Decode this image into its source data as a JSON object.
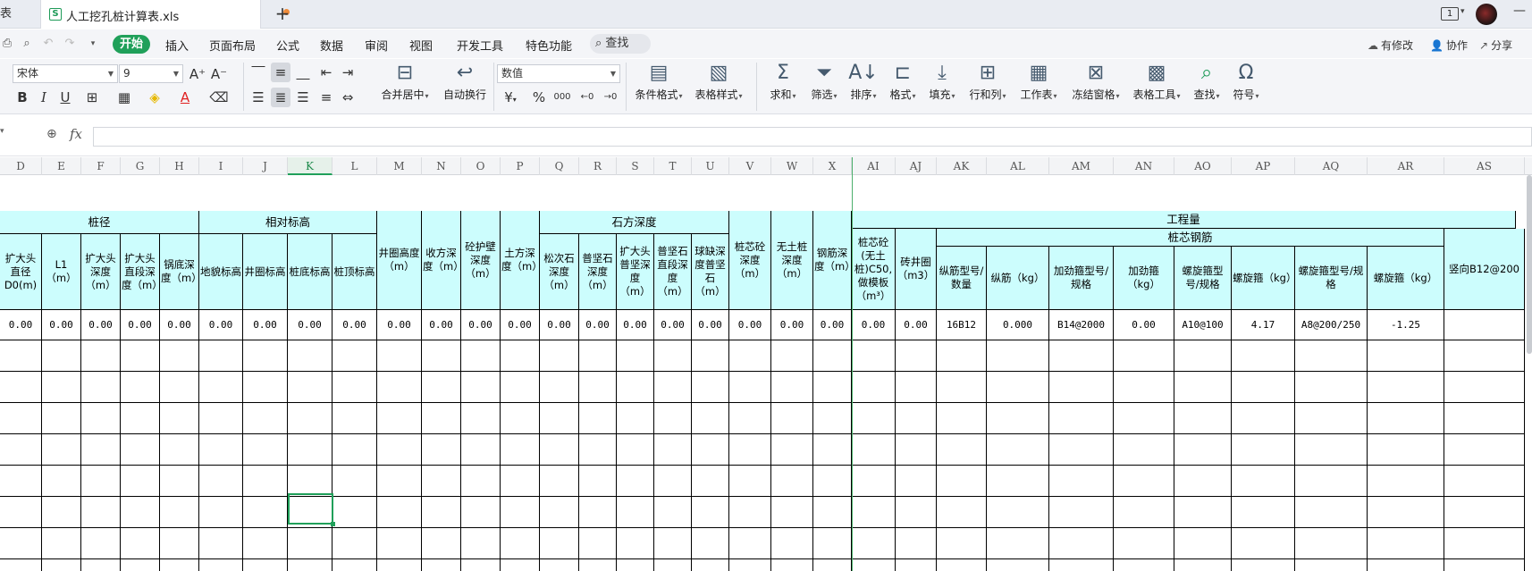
{
  "tabbar": {
    "prev_tab_label": "表",
    "doc_title": "人工挖孔桩计算表.xls",
    "new_tab": "+",
    "page_icon_label": "1"
  },
  "menu": {
    "items": [
      "开始",
      "插入",
      "页面布局",
      "公式",
      "数据",
      "审阅",
      "视图",
      "开发工具",
      "特色功能"
    ],
    "search": "查找",
    "right": [
      "有修改",
      "协作",
      "分享"
    ]
  },
  "ribbon": {
    "font_name": "宋体",
    "font_size": "9",
    "number_format": "数值",
    "merge_label": "合并居中",
    "wrap_label": "自动换行",
    "cond_format": "条件格式",
    "table_style": "表格样式",
    "tools": [
      "求和",
      "筛选",
      "排序",
      "格式",
      "填充",
      "行和列",
      "工作表",
      "冻结窗格",
      "表格工具",
      "查找",
      "符号"
    ],
    "currency": "¥",
    "percent": "%",
    "thousands": "000"
  },
  "formula": {
    "fx": "fx",
    "value": ""
  },
  "colors": {
    "header_bg": "#ccfdfd",
    "accent": "#20a05a"
  },
  "columns": [
    "D",
    "E",
    "F",
    "G",
    "H",
    "I",
    "J",
    "K",
    "L",
    "M",
    "N",
    "O",
    "P",
    "Q",
    "R",
    "S",
    "T",
    "U",
    "V",
    "W",
    "X",
    "AI",
    "AJ",
    "AK",
    "AL",
    "AM",
    "AN",
    "AO",
    "AP",
    "AQ",
    "AR",
    "AS"
  ],
  "groups": {
    "pile_diameter": "桩径",
    "relative_elev": "相对标高",
    "rock_depth": "石方深度",
    "quantities": "工程量",
    "core_rebar": "桩芯钢筋"
  },
  "headers": {
    "D": "扩大头直径D0(m)",
    "E": "L1（m）",
    "F": "扩大头深度（m）",
    "G": "扩大头直段深度（m）",
    "H": "锅底深度（m）",
    "I": "地貌标高",
    "J": "井圈标高",
    "K": "桩底标高",
    "L": "桩顶标高",
    "M": "井圈高度（m）",
    "N": "收方深度（m）",
    "O": "砼护壁深度（m）",
    "P": "土方深度（m）",
    "Q": "松次石深度（m）",
    "R": "普坚石深度（m）",
    "S": "扩大头普坚深度（m）",
    "T": "普坚石直段深度（m）",
    "U": "球缺深度普坚石（m）",
    "V": "桩芯砼深度（m）",
    "W": "无土桩深度（m）",
    "X": "钢筋深度（m）",
    "AI": "桩芯砼(无土桩)C50,做模板（m³）",
    "AJ": "砖井圈（m3）",
    "AK": "纵筋型号/数量",
    "AL": "纵筋（kg）",
    "AM": "加劲箍型号/规格",
    "AN": "加劲箍（kg）",
    "AO": "螺旋箍型号/规格",
    "AP": "螺旋箍（kg）",
    "AQ": "螺旋箍型号/规格",
    "AR": "螺旋箍（kg）",
    "AS": "竖向B12@200"
  },
  "row1": [
    "0.00",
    "0.00",
    "0.00",
    "0.00",
    "0.00",
    "0.00",
    "0.00",
    "0.00",
    "0.00",
    "0.00",
    "0.00",
    "0.00",
    "0.00",
    "0.00",
    "0.00",
    "0.00",
    "0.00",
    "0.00",
    "0.00",
    "0.00",
    "0.00",
    "0.00",
    "0.00",
    "16B12",
    "0.000",
    "B14@2000",
    "0.00",
    "A10@100",
    "4.17",
    "A8@200/250",
    "-1.25",
    ""
  ]
}
